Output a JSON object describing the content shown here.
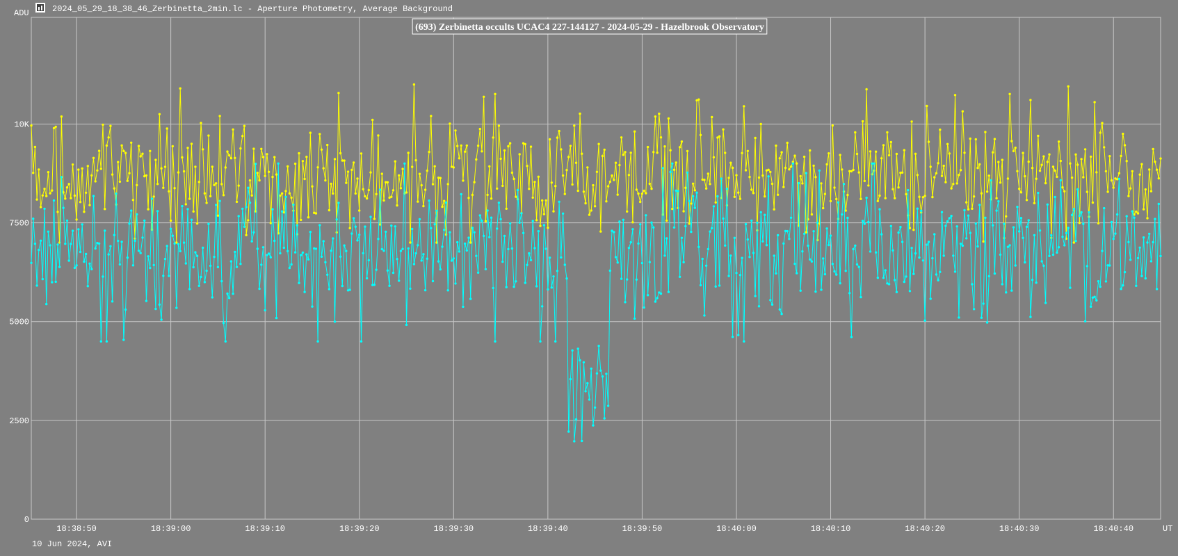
{
  "window": {
    "title": "2024_05_29_18_38_46_Zerbinetta_2min.lc - Aperture Photometry, Average Background",
    "icon": "lightcurve-icon"
  },
  "footer": {
    "date_text": "10 Jun 2024, AVI"
  },
  "colors": {
    "background": "#808080",
    "grid": "#c8c8c8",
    "target_series": "#ffff00",
    "comparison_series": "#00ffff",
    "text": "#ffffff"
  },
  "chart_data": {
    "type": "line",
    "title": "(693) Zerbinetta occults UCAC4 227-144127 - 2024-05-29 - Hazelbrook Observatory",
    "ylabel": "ADU",
    "xlabel": "UT",
    "ylim": [
      0,
      12700
    ],
    "xlim": [
      "18:38:45.2",
      "18:40:45.0"
    ],
    "y_ticks": [
      {
        "value": 0,
        "label": "0"
      },
      {
        "value": 2500,
        "label": "2500"
      },
      {
        "value": 5000,
        "label": "5000"
      },
      {
        "value": 7500,
        "label": "7500"
      },
      {
        "value": 10000,
        "label": "10K"
      }
    ],
    "x_ticks": [
      "18:38:50",
      "18:39:00",
      "18:39:10",
      "18:39:20",
      "18:39:30",
      "18:39:40",
      "18:39:50",
      "18:40:00",
      "18:40:10",
      "18:40:20",
      "18:40:30",
      "18:40:40"
    ],
    "grid": true,
    "series": [
      {
        "color": "#ffff00",
        "point_count": 600,
        "baseline_adu": 8700,
        "noise_range_adu": [
          7000,
          11000
        ]
      },
      {
        "color": "#00ffff",
        "point_count": 600,
        "baseline_adu": 6800,
        "noise_range_adu": [
          4500,
          9000
        ],
        "event": {
          "start": "18:39:42.2",
          "end": "18:39:46.4",
          "level_range_adu": [
            1900,
            4400
          ]
        }
      }
    ]
  }
}
